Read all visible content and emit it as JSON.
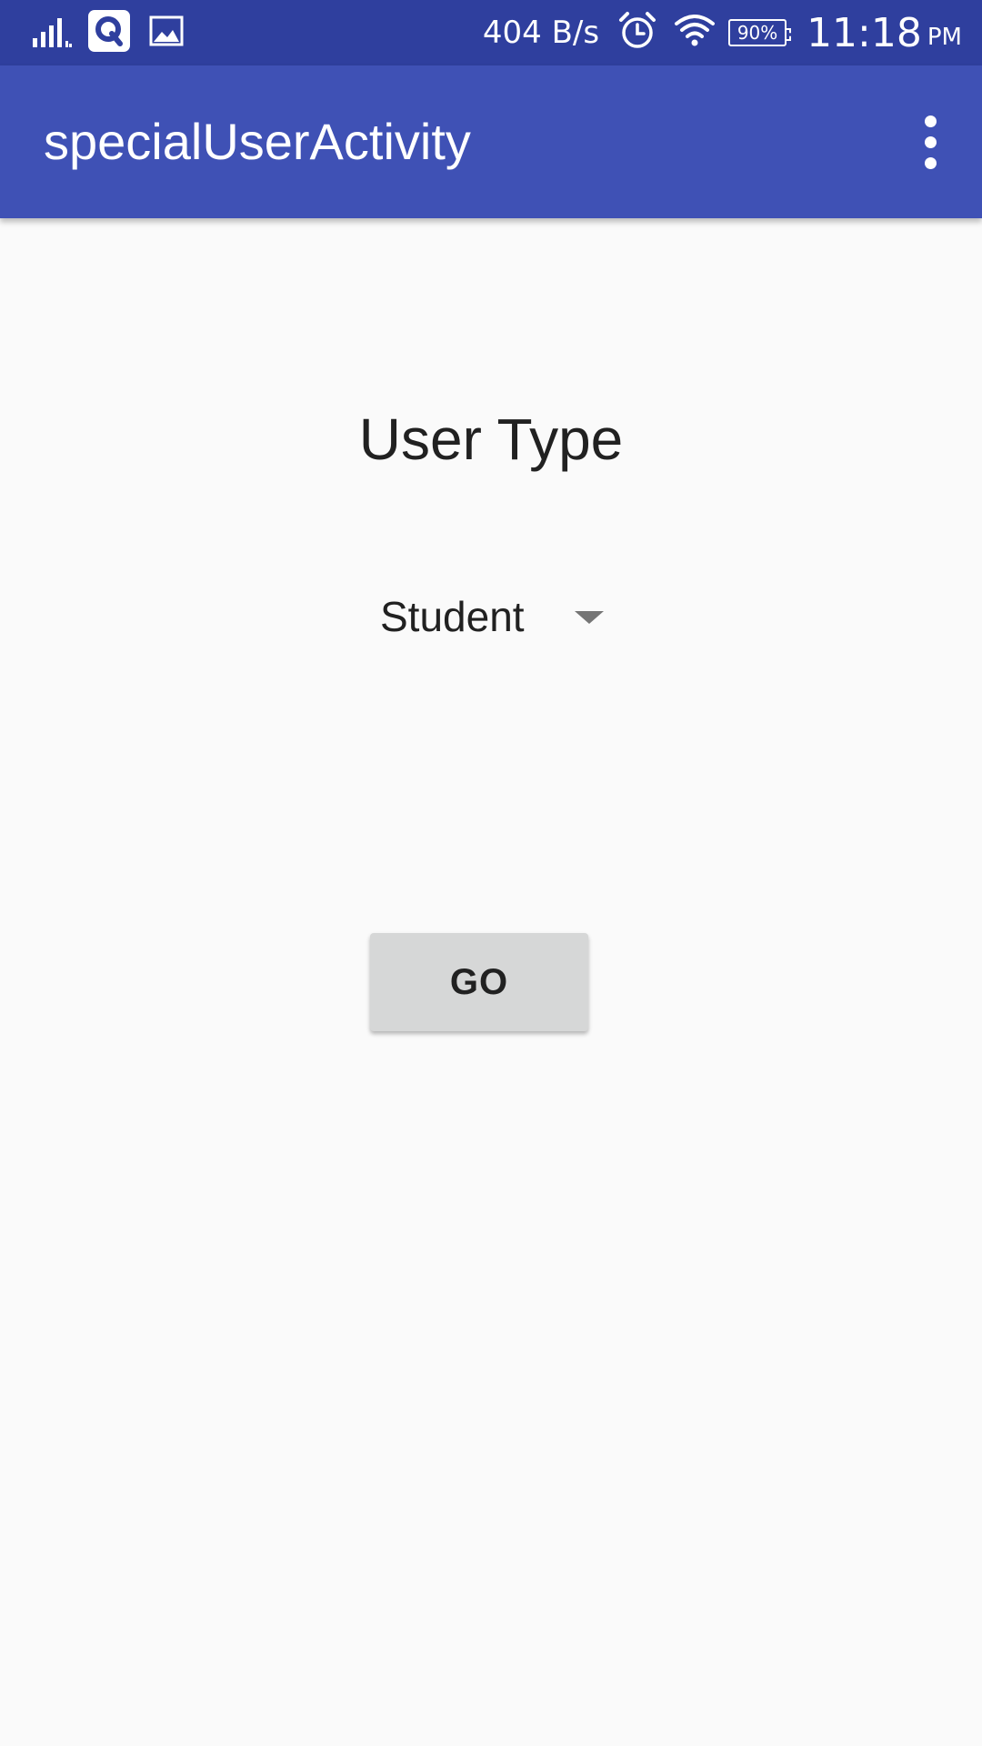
{
  "status_bar": {
    "network_speed": "404 B/s",
    "battery_percent": "90%",
    "time": "11:18",
    "am_pm": "PM",
    "icons": [
      "signal-icon",
      "q-app-icon",
      "image-icon",
      "alarm-icon",
      "wifi-icon",
      "battery-icon"
    ]
  },
  "app_bar": {
    "title": "specialUserActivity",
    "menu_icon": "overflow-menu-icon"
  },
  "main": {
    "user_type_label": "User Type",
    "spinner": {
      "selected": "Student"
    },
    "go_button_label": "GO"
  },
  "colors": {
    "status_bar": "#2f3f9e",
    "app_bar": "#3f51b5",
    "background": "#fafafa",
    "button": "#d6d7d7",
    "text": "#212121"
  }
}
